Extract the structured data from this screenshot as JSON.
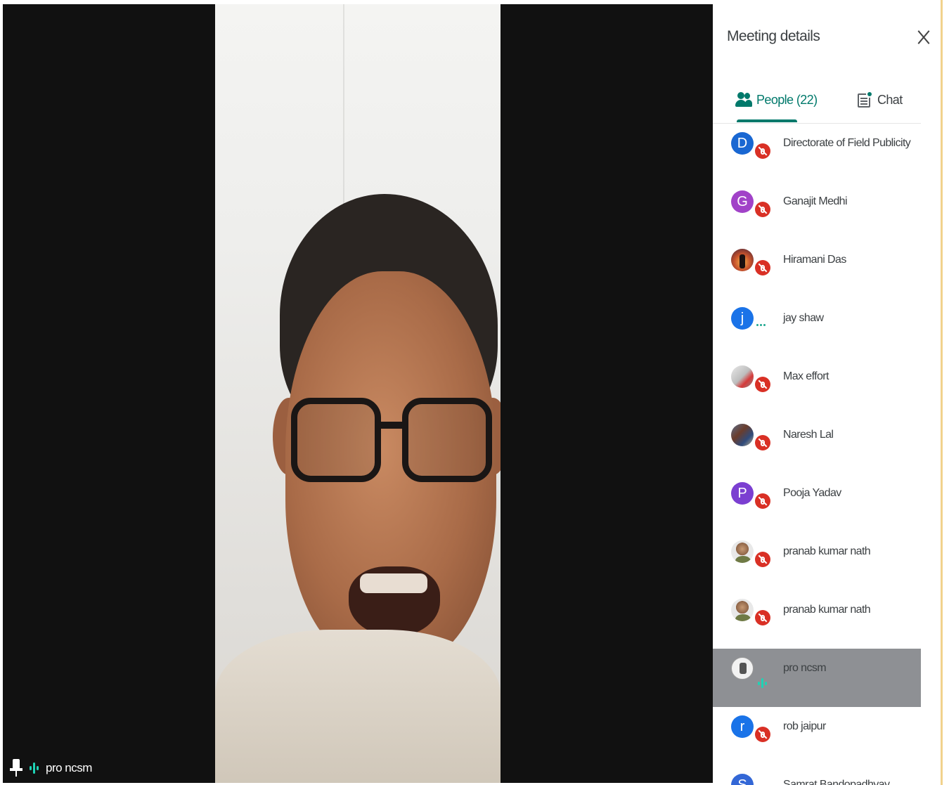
{
  "stage": {
    "pinned_participant": "pro ncsm"
  },
  "panel": {
    "title": "Meeting details",
    "tabs": {
      "people_label": "People (22)",
      "chat_label": "Chat"
    },
    "people": [
      {
        "name": "Directorate of Field Publicity",
        "initial": "D",
        "color": "#1967d2",
        "status": "muted"
      },
      {
        "name": "Ganajit Medhi",
        "initial": "G",
        "color": "#a142c8",
        "status": "muted"
      },
      {
        "name": "Hiramani Das",
        "initial": "",
        "color": "",
        "photo": "sunset",
        "status": "muted"
      },
      {
        "name": "jay shaw",
        "initial": "j",
        "color": "#1a73e8",
        "status": "typing"
      },
      {
        "name": "Max effort",
        "initial": "",
        "color": "",
        "photo": "machine",
        "status": "muted"
      },
      {
        "name": "Naresh Lal",
        "initial": "",
        "color": "",
        "photo": "group",
        "status": "muted"
      },
      {
        "name": "Pooja Yadav",
        "initial": "P",
        "color": "#7b3fd1",
        "status": "muted"
      },
      {
        "name": "pranab kumar nath",
        "initial": "",
        "color": "",
        "photo": "man",
        "status": "muted"
      },
      {
        "name": "pranab kumar nath",
        "initial": "",
        "color": "",
        "photo": "man",
        "status": "muted"
      },
      {
        "name": "pro ncsm",
        "initial": "",
        "color": "",
        "photo": "seal",
        "status": "speaking",
        "active": true
      },
      {
        "name": "rob jaipur",
        "initial": "r",
        "color": "#1a73e8",
        "status": "muted"
      },
      {
        "name": "Samrat Bandopadhyay",
        "initial": "S",
        "color": "#3367d6",
        "status": "muted"
      }
    ]
  },
  "colors": {
    "accent": "#00796b",
    "mute_red": "#d93025",
    "speaking_teal": "#1fd3b5"
  }
}
